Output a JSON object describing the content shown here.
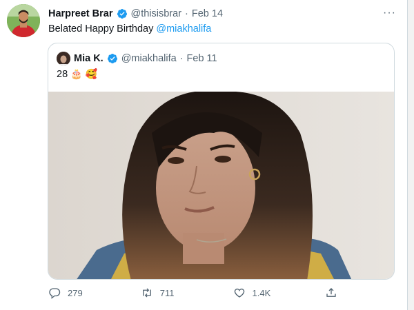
{
  "tweet": {
    "author_name": "Harpreet Brar",
    "handle": "@thisisbrar",
    "separator": "·",
    "date": "Feb 14",
    "more_label": "···",
    "text_prefix": "Belated Happy Birthday ",
    "mention": "@miakhalifa"
  },
  "quoted": {
    "author_name": "Mia K.",
    "handle": "@miakhalifa",
    "separator": "·",
    "date": "Feb 11",
    "text": "28",
    "emoji_1": "🎂",
    "emoji_2": "🥰"
  },
  "actions": {
    "replies": "279",
    "retweets": "711",
    "likes": "1.4K"
  },
  "icons": {
    "verified": "verified-badge-icon",
    "reply": "reply-icon",
    "retweet": "retweet-icon",
    "like": "heart-icon",
    "share": "share-icon"
  },
  "colors": {
    "link": "#1d9bf0",
    "muted": "#536471",
    "border": "#cfd9de"
  }
}
